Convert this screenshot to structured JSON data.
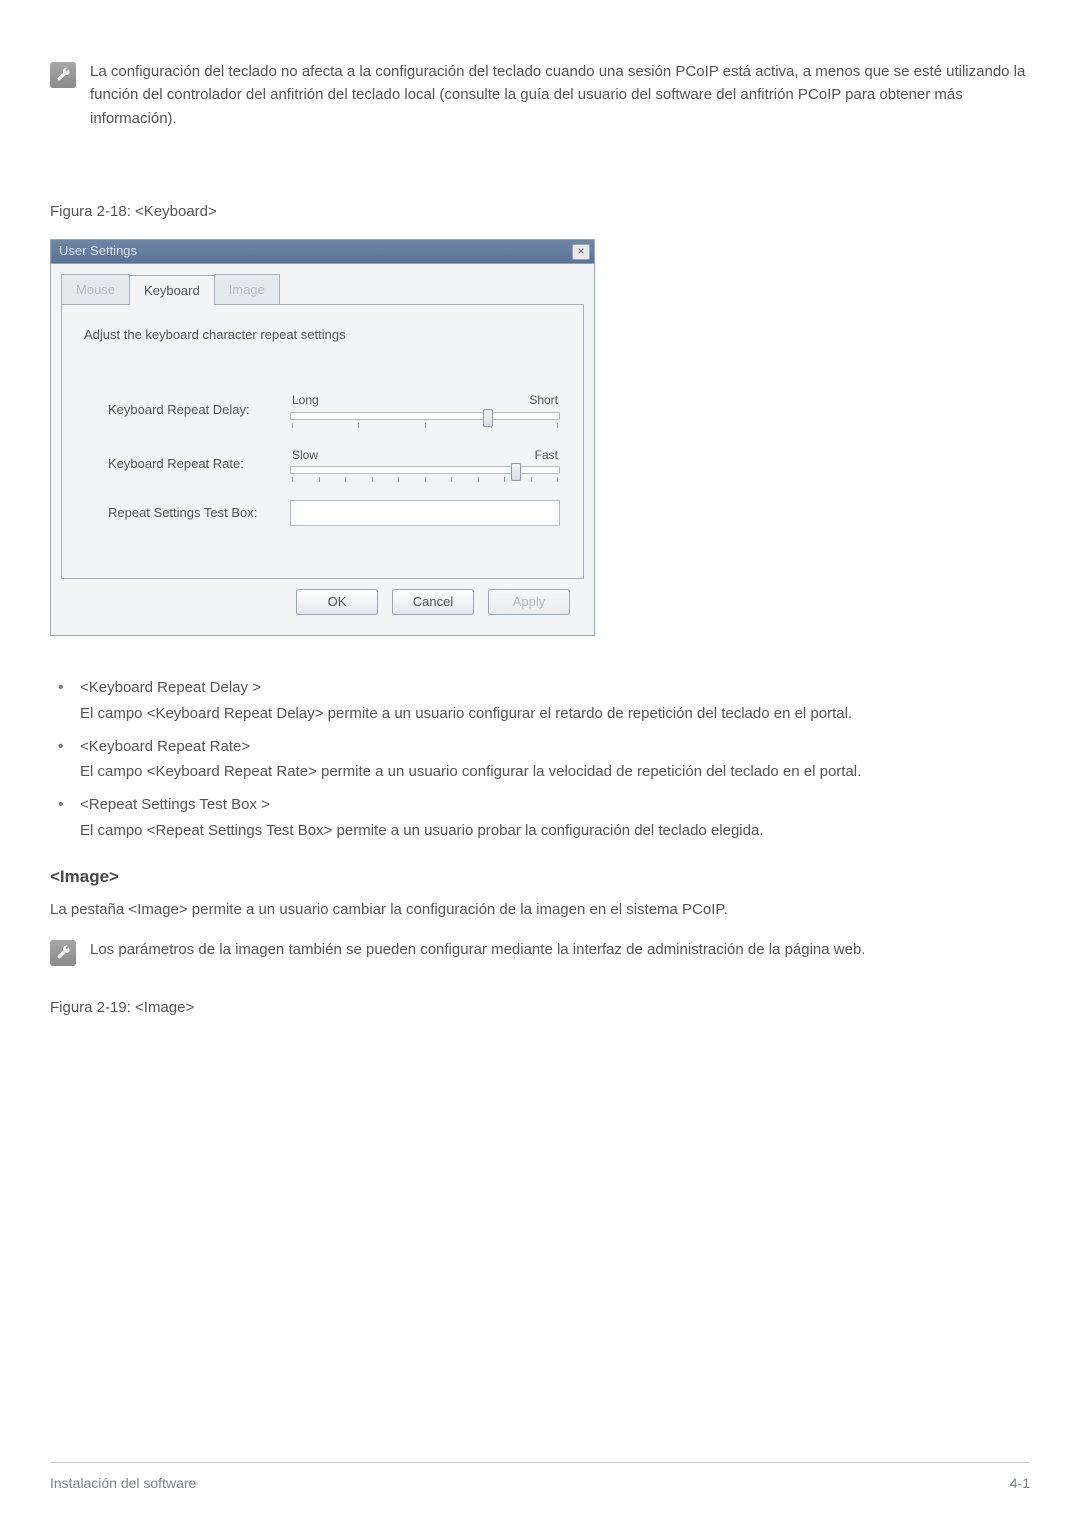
{
  "note1": "La configuración del teclado no afecta a la configuración del teclado cuando una sesión PCoIP está activa, a menos que se esté utilizando la función del controlador del anfitrión del teclado local (consulte la guía del usuario del software del anfitrión PCoIP para obtener más información).",
  "fig_caption_1": "Figura 2-18: <Keyboard>",
  "dialog": {
    "title": "User Settings",
    "close_glyph": "×",
    "tabs": {
      "mouse": "Mouse",
      "keyboard": "Keyboard",
      "image": "Image"
    },
    "panel_heading": "Adjust the keyboard character repeat settings",
    "rows": {
      "delay": {
        "label": "Keyboard Repeat Delay:",
        "left": "Long",
        "right": "Short"
      },
      "rate": {
        "label": "Keyboard Repeat Rate:",
        "left": "Slow",
        "right": "Fast"
      },
      "test": {
        "label": "Repeat Settings Test Box:"
      }
    },
    "buttons": {
      "ok": "OK",
      "cancel": "Cancel",
      "apply": "Apply"
    }
  },
  "bullets": [
    {
      "title": "<Keyboard Repeat Delay >",
      "desc": "El campo <Keyboard Repeat Delay> permite a un usuario configurar el retardo de repetición del teclado en el portal."
    },
    {
      "title": "<Keyboard Repeat Rate>",
      "desc": "El campo <Keyboard Repeat Rate> permite a un usuario configurar la velocidad de repetición del teclado en el portal."
    },
    {
      "title": "<Repeat Settings Test Box >",
      "desc": "El campo <Repeat Settings Test Box> permite a un usuario probar la configuración del teclado elegida."
    }
  ],
  "image_section": {
    "heading": "<Image>",
    "para": "La pestaña <Image> permite a un usuario cambiar la configuración de la imagen en el sistema PCoIP.",
    "note": "Los parámetros de la imagen también se pueden configurar mediante la interfaz de administración de la página web."
  },
  "fig_caption_2": "Figura 2-19: <Image>",
  "footer": {
    "left": "Instalación del software",
    "right": "4-1"
  }
}
